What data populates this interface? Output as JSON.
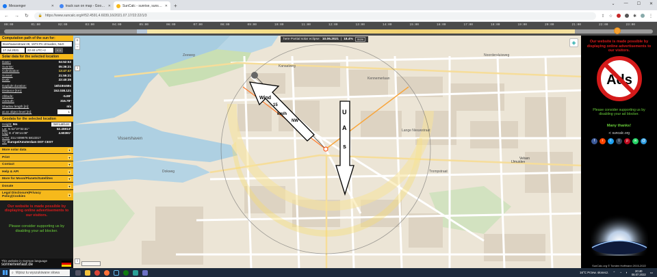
{
  "browser": {
    "tabs": [
      {
        "label": "Messenger",
        "color": "#1877f2",
        "active": false
      },
      {
        "label": "track sun on map - Google Sea",
        "color": "#4285f4",
        "active": false
      },
      {
        "label": "SunCalc - sunrise, sunset, sho",
        "color": "#f6b91b",
        "active": true
      }
    ],
    "new_tab": "+",
    "url": "https://www.suncalc.org/#/52.4591,4.6039,16/2021.07.17/22:22/1/3"
  },
  "timebar": {
    "hours": [
      "00:00",
      "01:00",
      "02:00",
      "03:00",
      "04:00",
      "05:00",
      "06:00",
      "07:00",
      "08:00",
      "09:00",
      "10:00",
      "11:00",
      "12:00",
      "13:00",
      "14:00",
      "15:00",
      "16:00",
      "17:00",
      "18:00",
      "19:00",
      "20:00",
      "21:00",
      "22:00",
      "23:00"
    ]
  },
  "left": {
    "header": "Computation path of the sun for:",
    "address": "Boerhaavestraat 28, 1973 PA IJmuiden, NLD",
    "date": "17.Jul.2021",
    "time": "22:40 UTC+2",
    "nav_btn": "« »",
    "solar_header": "Solar data for the selected location",
    "solar": [
      {
        "k": "Dawn:",
        "v": "04:52:53"
      },
      {
        "k": "Sunrise:",
        "v": "05:36:21"
      },
      {
        "k": "Culmination:",
        "v": "13:47:47",
        "y": true
      },
      {
        "k": "Sunset:",
        "v": "21:55:21"
      },
      {
        "k": "Dusk:",
        "v": "22:40:35"
      }
    ],
    "solar2": [
      {
        "k": "Daylight duration:",
        "v": "16h19m59s"
      },
      {
        "k": "Distance [km]:",
        "v": "152.038.121"
      }
    ],
    "solar3": [
      {
        "k": "Altitude:",
        "v": "-5.99°"
      },
      {
        "k": "Azimuth:",
        "v": "316.78°"
      }
    ],
    "shadow_label": "Shadow length [m]:",
    "shadow_value": "n/a",
    "object_label": "at an object level [m]:",
    "object_value": "1",
    "geo_header": "Geodata for the selected location",
    "height_label": "Height:",
    "height_value": "9m",
    "set_btn": "Set Lat/Lon",
    "lat_label": "Lat:",
    "lat_value": "N 52°27'32.51\"",
    "lat_dec": "52.45914°",
    "lon_label": "Lng:",
    "lon_value": "E 4°36'14.08\"",
    "lon_dec": "4.60391°",
    "utm_label": "UTM:",
    "utm_value": "31U 609976 5813317",
    "tz_label": "TZ:",
    "tz_value": "Europe/Amsterdam DST CEST",
    "menus": [
      "More solar data",
      "Print",
      "Contact",
      "Help & API",
      "More for Moon/Planets/Satellites",
      "Donate"
    ],
    "legal": "Legal Disclosure|Privacy Policy|Cookies",
    "ad_red": "Our website is made possible by displaying online advertisements to our visitors.",
    "ad_green": "Please consider supporting us by disabling your ad blocker.",
    "footer_line1": "This website in German language",
    "footer_line2": "sonnenverlauf.de"
  },
  "map": {
    "eclipse_text": "here Partial solar eclipse:",
    "eclipse_date": "10.06.2021",
    "eclipse_pct": "18.4%",
    "eclipse_more": "more",
    "place_labels": [
      "Vissershaven",
      "IJmuiden",
      "Velsen",
      "Kanaalweg",
      "Kennemerlaan",
      "Lange Nieuwstraat",
      "Trompstraat",
      "Zeeweg",
      "Dokweg",
      "Noordersluisweg"
    ],
    "wind_label": "Wind",
    "wind_speed": "15",
    "wind_unit": "km/h",
    "wind_dir": "NW",
    "letters": [
      "U",
      "A",
      "s"
    ]
  },
  "right": {
    "ad_red": "Our website is made possible by displaying online advertisements to our visitors.",
    "ads_word": "Ads",
    "ad_green": "Please consider supporting us by disabling your ad blocker.",
    "thanks": "Many thanks!",
    "share": "suncalc.org",
    "copyright": "SunCalc.org © Torsten Hoffmann 2015-2022"
  },
  "taskbar": {
    "search_placeholder": "Wpisz tu wyszukiwane słowa",
    "weather": "16°C  Przew. słonecz.",
    "time": "20:40",
    "date": "08.07.2022"
  }
}
